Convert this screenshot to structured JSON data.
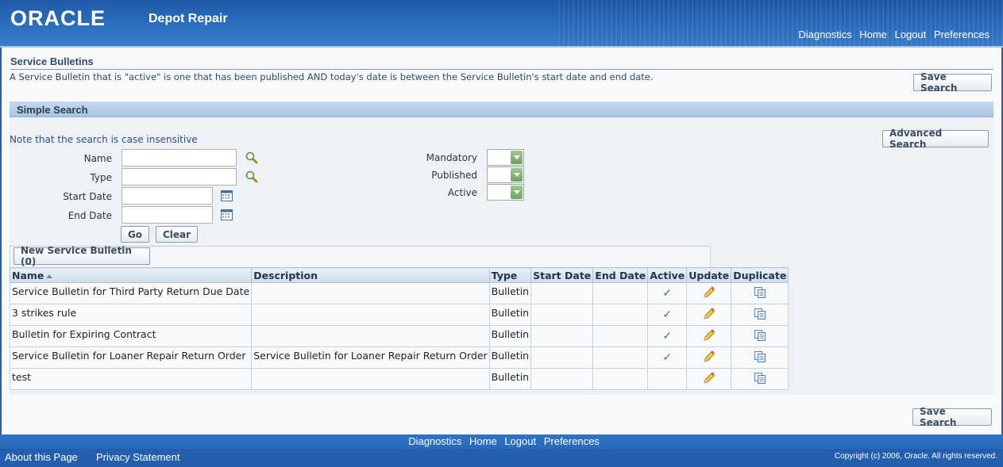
{
  "header": {
    "brand": "ORACLE",
    "app_name": "Depot Repair",
    "links": [
      "Diagnostics",
      "Home",
      "Logout",
      "Preferences"
    ]
  },
  "page": {
    "title": "Service Bulletins",
    "instruction": "A Service Bulletin that is \"active\" is one that has been published AND today's date is between the Service Bulletin's start date and end date.",
    "save_search_label": "Save Search"
  },
  "simple_search": {
    "title": "Simple Search",
    "note": "Note that the search is case insensitive",
    "advanced_search_label": "Advanced Search",
    "name_label": "Name",
    "type_label": "Type",
    "start_date_label": "Start Date",
    "end_date_label": "End Date",
    "mandatory_label": "Mandatory",
    "published_label": "Published",
    "active_label": "Active",
    "name_value": "",
    "type_value": "",
    "start_date_value": "",
    "end_date_value": "",
    "go_label": "Go",
    "clear_label": "Clear"
  },
  "results": {
    "new_button_label": "New Service Bulletin (0)",
    "columns": [
      "Name",
      "Description",
      "Type",
      "Start Date",
      "End Date",
      "Active",
      "Update",
      "Duplicate"
    ],
    "rows": [
      {
        "name": "Service Bulletin for Third Party Return Due Date",
        "description": "",
        "type": "Bulletin",
        "start": "",
        "end": "",
        "active": "✓"
      },
      {
        "name": "3 strikes rule",
        "description": "",
        "type": "Bulletin",
        "start": "",
        "end": "",
        "active": "✓"
      },
      {
        "name": "Bulletin for Expiring Contract",
        "description": "",
        "type": "Bulletin",
        "start": "",
        "end": "",
        "active": "✓"
      },
      {
        "name": "Service Bulletin for Loaner Repair Return Order",
        "description": "Service Bulletin for Loaner Repair Return Order",
        "type": "Bulletin",
        "start": "",
        "end": "",
        "active": "✓"
      },
      {
        "name": "test",
        "description": "",
        "type": "Bulletin",
        "start": "",
        "end": "",
        "active": ""
      }
    ]
  },
  "footer": {
    "links": [
      "Diagnostics",
      "Home",
      "Logout",
      "Preferences"
    ],
    "about": "About this Page",
    "privacy": "Privacy Statement",
    "copyright": "Copyright (c) 2006, Oracle. All rights reserved."
  },
  "icons": {
    "search": "magnifier-icon",
    "calendar": "calendar-icon",
    "update": "pencil-icon",
    "duplicate": "copy-icon"
  }
}
